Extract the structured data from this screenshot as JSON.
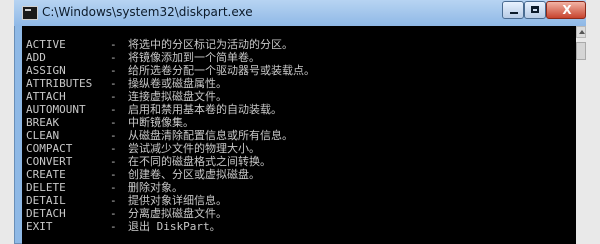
{
  "window": {
    "title": "C:\\Windows\\system32\\diskpart.exe",
    "close_symbol": "X"
  },
  "console": {
    "lines": [
      {
        "cmd": "ACTIVE",
        "dash": "-",
        "desc": "将选中的分区标记为活动的分区。"
      },
      {
        "cmd": "ADD",
        "dash": "-",
        "desc": "将镜像添加到一个简单卷。"
      },
      {
        "cmd": "ASSIGN",
        "dash": "-",
        "desc": "给所选卷分配一个驱动器号或装载点。"
      },
      {
        "cmd": "ATTRIBUTES",
        "dash": "-",
        "desc": "操纵卷或磁盘属性。"
      },
      {
        "cmd": "ATTACH",
        "dash": "-",
        "desc": "连接虚拟磁盘文件。"
      },
      {
        "cmd": "AUTOMOUNT",
        "dash": "-",
        "desc": "启用和禁用基本卷的自动装载。"
      },
      {
        "cmd": "BREAK",
        "dash": "-",
        "desc": "中断镜像集。"
      },
      {
        "cmd": "CLEAN",
        "dash": "-",
        "desc": "从磁盘清除配置信息或所有信息。"
      },
      {
        "cmd": "COMPACT",
        "dash": "-",
        "desc": "尝试减少文件的物理大小。"
      },
      {
        "cmd": "CONVERT",
        "dash": "-",
        "desc": "在不同的磁盘格式之间转换。"
      },
      {
        "cmd": "CREATE",
        "dash": "-",
        "desc": "创建卷、分区或虚拟磁盘。"
      },
      {
        "cmd": "DELETE",
        "dash": "-",
        "desc": "删除对象。"
      },
      {
        "cmd": "DETAIL",
        "dash": "-",
        "desc": "提供对象详细信息。"
      },
      {
        "cmd": "DETACH",
        "dash": "-",
        "desc": "分离虚拟磁盘文件。"
      },
      {
        "cmd": "EXIT",
        "dash": "-",
        "desc": "退出 DiskPart。"
      }
    ]
  }
}
